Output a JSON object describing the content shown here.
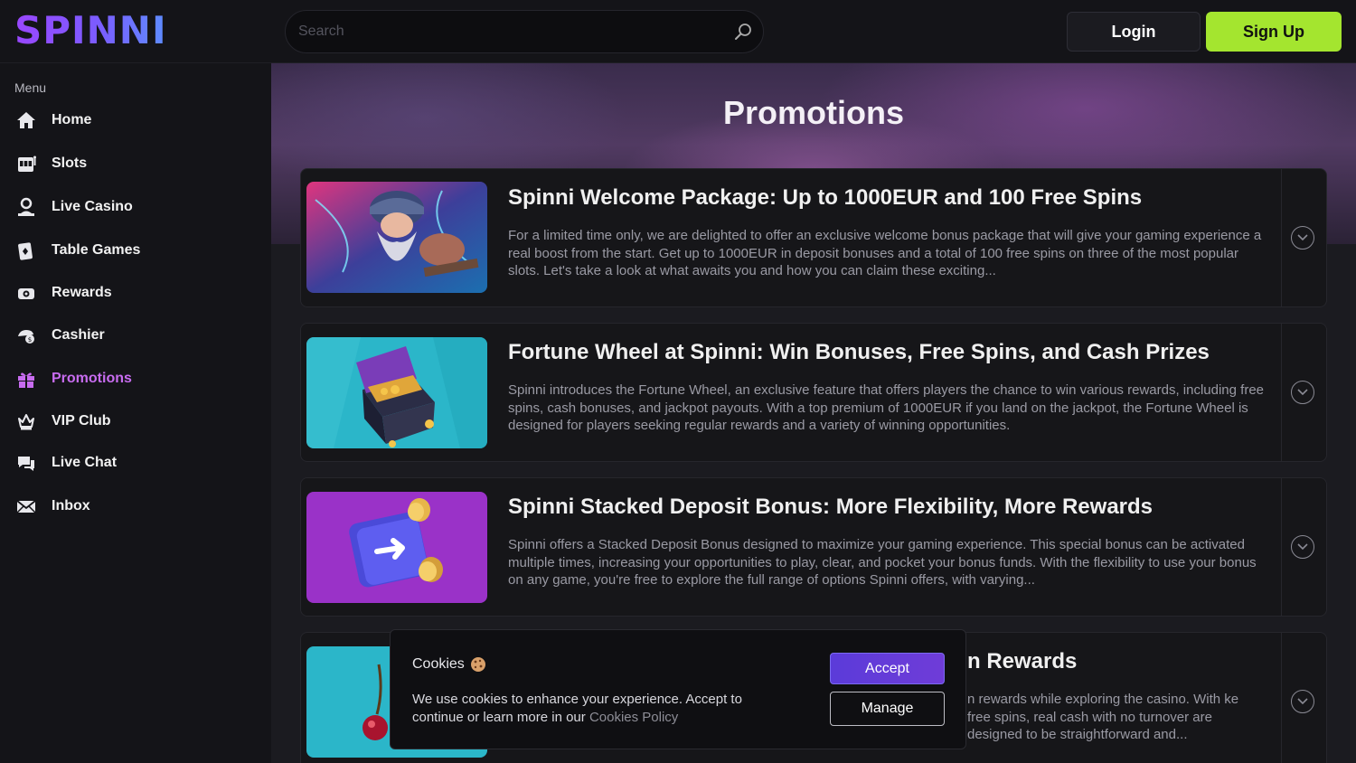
{
  "header": {
    "logo": "SPINNI",
    "search_placeholder": "Search",
    "login_label": "Login",
    "signup_label": "Sign Up"
  },
  "sidebar": {
    "menu_label": "Menu",
    "items": [
      {
        "label": "Home",
        "icon": "home-icon"
      },
      {
        "label": "Slots",
        "icon": "slots-icon"
      },
      {
        "label": "Live Casino",
        "icon": "live-casino-icon"
      },
      {
        "label": "Table Games",
        "icon": "table-games-icon"
      },
      {
        "label": "Rewards",
        "icon": "rewards-icon"
      },
      {
        "label": "Cashier",
        "icon": "cashier-icon"
      },
      {
        "label": "Promotions",
        "icon": "gift-icon",
        "active": true
      },
      {
        "label": "VIP Club",
        "icon": "crown-icon"
      },
      {
        "label": "Live Chat",
        "icon": "chat-icon"
      },
      {
        "label": "Inbox",
        "icon": "envelope-icon"
      }
    ]
  },
  "main": {
    "title": "Promotions",
    "promotions": [
      {
        "title": "Spinni Welcome Package: Up to 1000EUR and 100 Free Spins",
        "description": "For a limited time only, we are delighted to offer an exclusive welcome bonus package that will give your gaming experience a real boost from the start. Get up to 1000EUR in deposit bonuses and a total of 100 free spins on three of the most popular slots. Let's take a look at what awaits you and how you can claim these exciting..."
      },
      {
        "title": "Fortune Wheel at Spinni: Win Bonuses, Free Spins, and Cash Prizes",
        "description": "Spinni introduces the Fortune Wheel, an exclusive feature that offers players the chance to win various rewards, including free spins, cash bonuses, and jackpot payouts. With a top premium of 1000EUR if you land on the jackpot, the Fortune Wheel is designed for players seeking regular rewards and a variety of winning opportunities."
      },
      {
        "title": "Spinni Stacked Deposit Bonus: More Flexibility, More Rewards",
        "description": "Spinni offers a Stacked Deposit Bonus designed to maximize your gaming experience. This special bonus can be activated multiple times, increasing your opportunities to play, clear, and pocket your bonus funds. With the flexibility to use your bonus on any game, you're free to explore the full range of options Spinni offers, with varying..."
      },
      {
        "title": "n Rewards",
        "description": "n rewards while exploring the casino. With ke free spins, real cash with no turnover are designed to be straightforward and..."
      }
    ]
  },
  "cookie": {
    "title": "Cookies",
    "text": "We use cookies to enhance your experience. Accept to continue or learn more in our ",
    "link": "Cookies Policy",
    "accept_label": "Accept",
    "manage_label": "Manage"
  },
  "colors": {
    "accent_green": "#a4e52f",
    "accent_purple": "#c86cf0",
    "accept_blue": "#5b3bd9"
  }
}
